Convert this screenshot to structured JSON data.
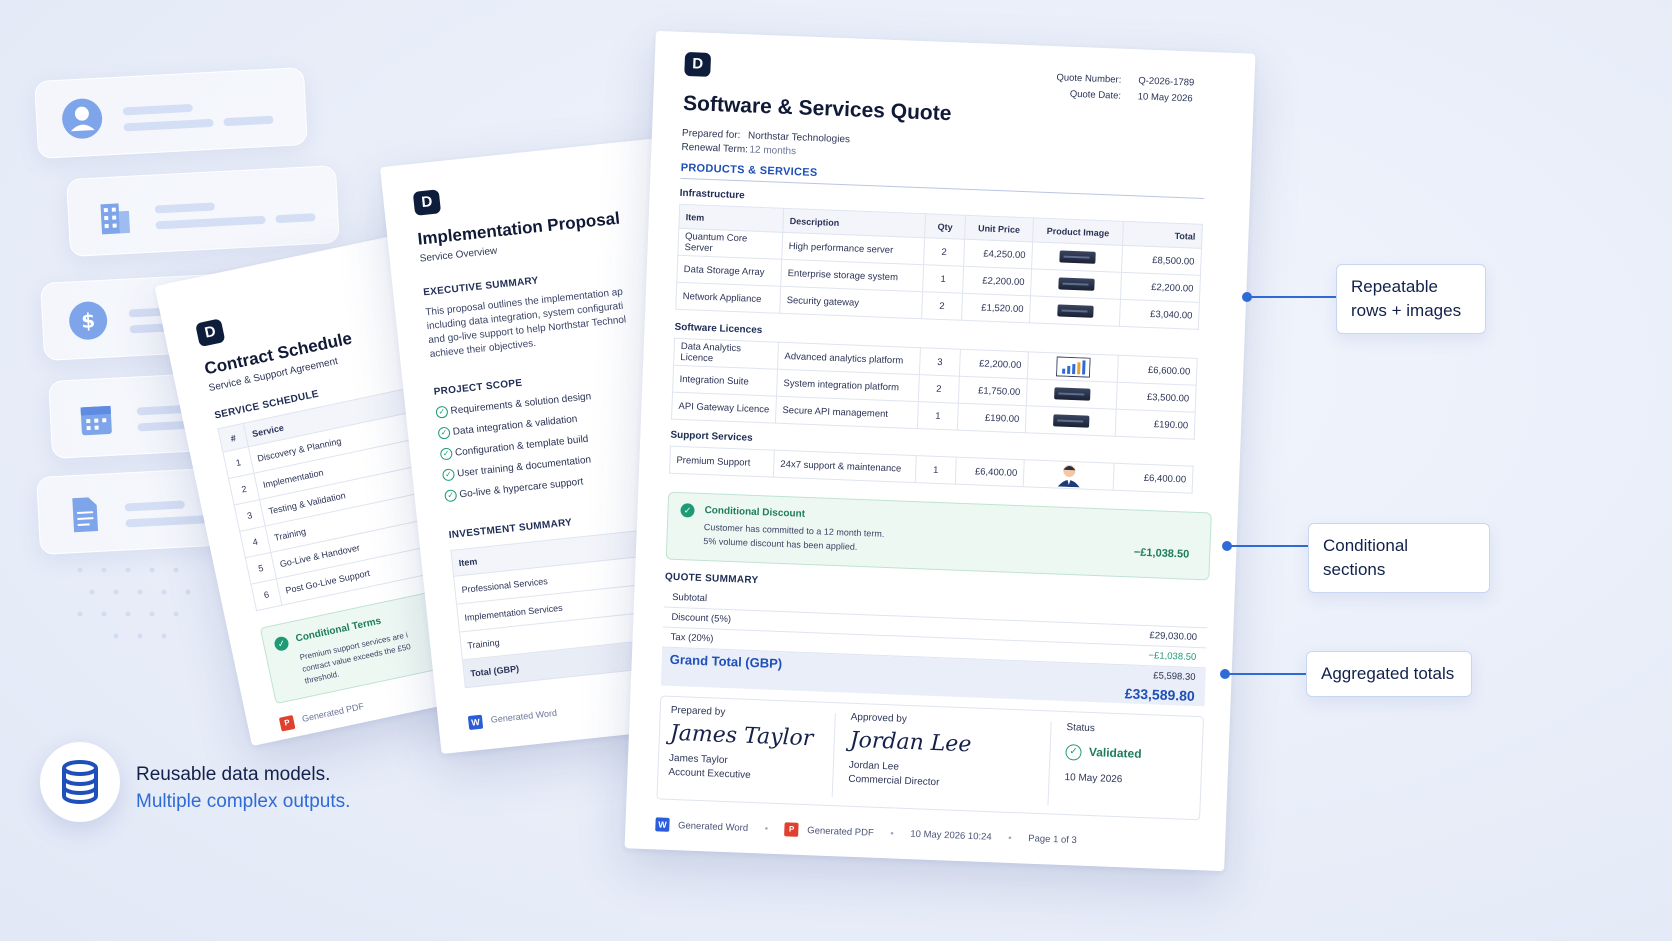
{
  "sources": [
    "user-icon",
    "building-icon",
    "dollar-icon",
    "calendar-icon",
    "document-icon"
  ],
  "tagline": {
    "line1": "Reusable data models.",
    "line2": "Multiple complex outputs.",
    "icon": "database-icon"
  },
  "callouts": {
    "repeatable": "Repeatable rows + images",
    "conditional": "Conditional sections",
    "aggregated": "Aggregated totals"
  },
  "contract": {
    "logo": "D",
    "title": "Contract Schedule",
    "subtitle": "Service & Support Agreement",
    "section": "SERVICE SCHEDULE",
    "col_num": "#",
    "col_service": "Service",
    "rows": [
      {
        "n": "1",
        "s": "Discovery & Planning"
      },
      {
        "n": "2",
        "s": "Implementation"
      },
      {
        "n": "3",
        "s": "Testing & Validation"
      },
      {
        "n": "4",
        "s": "Training"
      },
      {
        "n": "5",
        "s": "Go-Live & Handover"
      },
      {
        "n": "6",
        "s": "Post Go-Live Support"
      }
    ],
    "cond_title": "Conditional Terms",
    "cond_text1": "Premium support services are i",
    "cond_text2": "contract value exceeds the £50",
    "cond_text3": "threshold.",
    "footer": "Generated PDF"
  },
  "proposal": {
    "logo": "D",
    "title": "Implementation Proposal",
    "subtitle": "Service Overview",
    "exec_h": "EXECUTIVE SUMMARY",
    "exec_lines": [
      "This proposal outlines the implementation ap",
      "including data integration, system configurati",
      "and go-live support to help Northstar Technol",
      "achieve their objectives."
    ],
    "scope_h": "PROJECT SCOPE",
    "scope": [
      "Requirements & solution design",
      "Data integration & validation",
      "Configuration & template build",
      "User training & documentation",
      "Go-live & hypercare support"
    ],
    "inv_h": "INVESTMENT SUMMARY",
    "inv_rows": [
      "Item",
      "Professional Services",
      "Implementation Services",
      "Training",
      "Total (GBP)"
    ],
    "footer": "Generated Word"
  },
  "quote": {
    "logo": "D",
    "title": "Software & Services Quote",
    "quote_number_label": "Quote Number:",
    "quote_number": "Q-2026-1789",
    "quote_date_label": "Quote Date:",
    "quote_date": "10 May 2026",
    "prepared_for_label": "Prepared for:",
    "prepared_for": "Northstar Technologies",
    "renewal_label": "Renewal Term:",
    "renewal": "12 months",
    "products_h": "PRODUCTS & SERVICES",
    "cols": {
      "item": "Item",
      "desc": "Description",
      "qty": "Qty",
      "unit": "Unit Price",
      "image": "Product Image",
      "total": "Total"
    },
    "groups": [
      {
        "name": "Infrastructure",
        "rows": [
          {
            "item": "Quantum Core Server",
            "desc": "High performance server",
            "qty": "2",
            "unit": "£4,250.00",
            "img": "server",
            "total": "£8,500.00"
          },
          {
            "item": "Data Storage Array",
            "desc": "Enterprise storage system",
            "qty": "1",
            "unit": "£2,200.00",
            "img": "server",
            "total": "£2,200.00"
          },
          {
            "item": "Network Appliance",
            "desc": "Security gateway",
            "qty": "2",
            "unit": "£1,520.00",
            "img": "server",
            "total": "£3,040.00"
          }
        ]
      },
      {
        "name": "Software Licences",
        "rows": [
          {
            "item": "Data Analytics Licence",
            "desc": "Advanced analytics platform",
            "qty": "3",
            "unit": "£2,200.00",
            "img": "chart",
            "total": "£6,600.00"
          },
          {
            "item": "Integration Suite",
            "desc": "System integration platform",
            "qty": "2",
            "unit": "£1,750.00",
            "img": "server",
            "total": "£3,500.00"
          },
          {
            "item": "API Gateway Licence",
            "desc": "Secure API management",
            "qty": "1",
            "unit": "£190.00",
            "img": "server",
            "total": "£190.00"
          }
        ]
      },
      {
        "name": "Support Services",
        "rows": [
          {
            "item": "Premium Support",
            "desc": "24x7 support & maintenance",
            "qty": "1",
            "unit": "£6,400.00",
            "img": "person",
            "total": "£6,400.00"
          }
        ]
      }
    ],
    "cond_title": "Conditional Discount",
    "cond_line1": "Customer has committed to a 12 month term.",
    "cond_line2": "5% volume discount has been applied.",
    "cond_amount": "−£1,038.50",
    "summary_h": "QUOTE SUMMARY",
    "summary": [
      {
        "label": "Subtotal",
        "value": ""
      },
      {
        "label": "Discount (5%)",
        "value": "£29,030.00"
      },
      {
        "label": "Tax (20%)",
        "value": "−£1,038.50"
      },
      {
        "label": "Grand Total (GBP)",
        "value": "£5,598.30"
      }
    ],
    "grand_total": "£33,589.80",
    "prepared_by_label": "Prepared by",
    "prepared_by_sig": "James Taylor",
    "prepared_by_name": "James Taylor",
    "prepared_by_role": "Account Executive",
    "approved_by_label": "Approved by",
    "approved_by_sig": "Jordan Lee",
    "approved_by_name": "Jordan Lee",
    "approved_by_role": "Commercial Director",
    "status_label": "Status",
    "status_value": "Validated",
    "status_date": "10 May 2026",
    "footer_word": "Generated Word",
    "footer_pdf": "Generated PDF",
    "footer_ts": "10 May 2026 10:24",
    "footer_page": "Page 1 of 3"
  },
  "colors": {
    "accent": "#2f6bd6",
    "navy": "#0f1d3d",
    "green": "#1e9b75",
    "grand": "#1f4fb8"
  }
}
